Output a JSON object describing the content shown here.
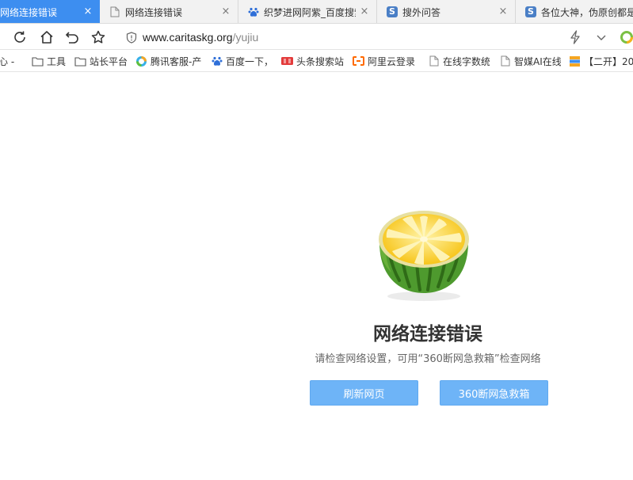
{
  "tabs": [
    {
      "title": "网络连接错误",
      "icon": "page-icon",
      "active": true
    },
    {
      "title": "网络连接错误",
      "icon": "page-icon",
      "active": false
    },
    {
      "title": "织梦进网阿紫_百度搜索",
      "icon": "baidu-paw-icon",
      "active": false
    },
    {
      "title": "搜外问答",
      "icon": "sowai-s-icon",
      "active": false
    },
    {
      "title": "各位大神，伪原创都是",
      "icon": "sowai-s-icon",
      "active": false
    }
  ],
  "tab_close_glyph": "×",
  "icon_letters": {
    "sowai": "S"
  },
  "address": {
    "host": "www.caritaskg.org",
    "path": "/yujiu"
  },
  "bookmarks": [
    {
      "label": "心 -",
      "icon": "none"
    },
    {
      "label": "工具",
      "icon": "folder-icon"
    },
    {
      "label": "站长平台",
      "icon": "folder-icon"
    },
    {
      "label": "腾讯客服-产",
      "icon": "tencent-icon"
    },
    {
      "label": "百度一下，",
      "icon": "baidu-paw-icon"
    },
    {
      "label": "头条搜索站",
      "icon": "toutiao-icon"
    },
    {
      "label": "阿里云登录",
      "icon": "aliyun-icon"
    },
    {
      "label": "在线字数统",
      "icon": "page-icon"
    },
    {
      "label": "智媒AI在线",
      "icon": "page-icon"
    },
    {
      "label": "【二开】20",
      "icon": "stack-icon"
    }
  ],
  "error": {
    "title": "网络连接错误",
    "description": "请检查网络设置，可用“360断网急救箱”检查网络",
    "refresh_label": "刷新网页",
    "rescue_label": "360断网急救箱",
    "illustration": "fruit-icon"
  },
  "colors": {
    "active_tab": "#3d8ef0",
    "button_bg": "#6eb4f7",
    "title_text": "#333333",
    "desc_text": "#666666"
  }
}
